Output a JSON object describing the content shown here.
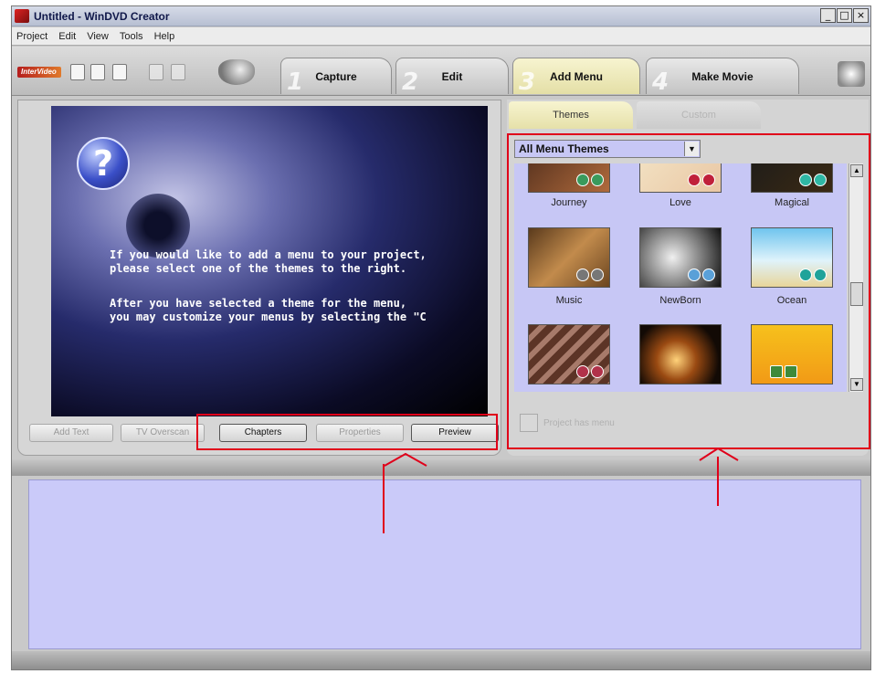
{
  "window": {
    "title": "Untitled - WinDVD Creator",
    "controls": {
      "minimize": "_",
      "maximize": "□",
      "close": "×"
    }
  },
  "menubar": {
    "items": [
      "Project",
      "Edit",
      "View",
      "Tools",
      "Help"
    ]
  },
  "toolbar": {
    "logo": "InterVideo",
    "steps": [
      {
        "num": "1",
        "label": "Capture"
      },
      {
        "num": "2",
        "label": "Edit"
      },
      {
        "num": "3",
        "label": "Add Menu"
      },
      {
        "num": "4",
        "label": "Make Movie"
      }
    ]
  },
  "preview": {
    "help_symbol": "?",
    "line1": "If you would like to add a menu to your project,",
    "line2": "please select one of the themes to the right.",
    "line3": "After you have selected a theme for the menu,",
    "line4": "you may customize your menus by selecting the \"C"
  },
  "preview_buttons": {
    "add_text": "Add Text",
    "tv_overscan": "TV Overscan",
    "chapters": "Chapters",
    "properties": "Properties",
    "preview": "Preview"
  },
  "right_panel": {
    "tabs": {
      "themes": "Themes",
      "custom": "Custom"
    },
    "theme_filter": "All Menu Themes",
    "themes": [
      {
        "name": "Journey"
      },
      {
        "name": "Love"
      },
      {
        "name": "Magical"
      },
      {
        "name": "Music"
      },
      {
        "name": "NewBorn"
      },
      {
        "name": "Ocean"
      },
      {
        "name": ""
      },
      {
        "name": ""
      },
      {
        "name": ""
      }
    ],
    "project_has_menu": "Project has menu"
  },
  "colors": {
    "annotation": "#e0001a",
    "timeline_bg": "#cacaf9",
    "active_tab": "#f7f4d0"
  }
}
